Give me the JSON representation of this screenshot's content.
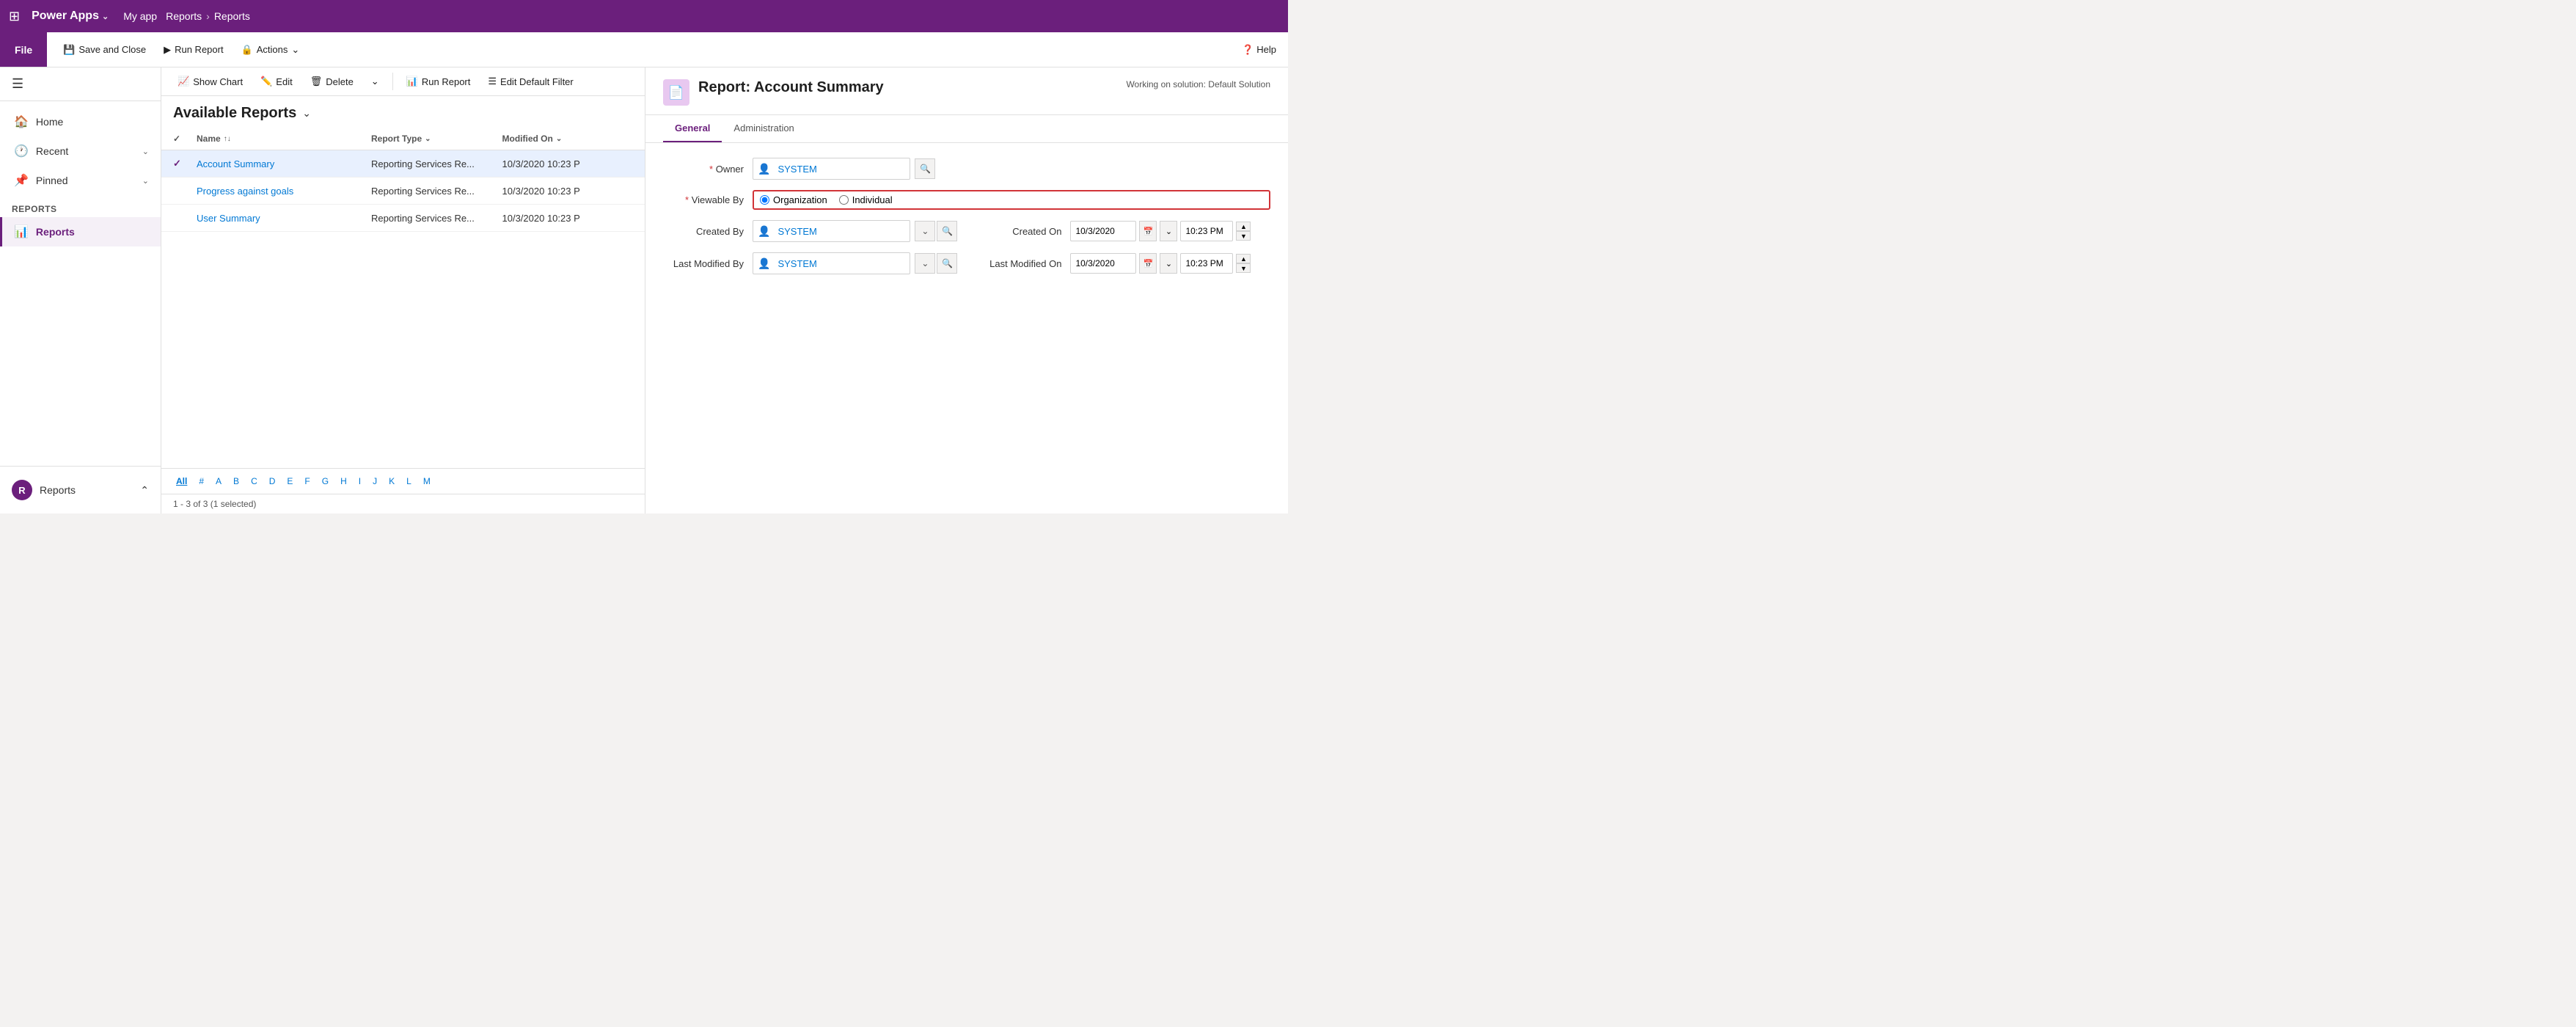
{
  "topnav": {
    "waffle": "⊞",
    "app_name": "Power Apps",
    "chevron": "⌄",
    "my_app": "My app",
    "breadcrumb": [
      "Reports",
      "Reports"
    ]
  },
  "ribbon": {
    "file_label": "File",
    "save_close_label": "Save and Close",
    "run_report_label": "Run Report",
    "actions_label": "Actions",
    "help_label": "Help",
    "save_icon": "💾",
    "run_icon": "▶",
    "actions_icon": "🔒"
  },
  "toolbar": {
    "show_chart": "Show Chart",
    "edit": "Edit",
    "delete": "Delete",
    "run_report": "Run Report",
    "edit_default_filter": "Edit Default Filter"
  },
  "content": {
    "header": "Available Reports",
    "table_headers": {
      "name": "Name",
      "report_type": "Report Type",
      "modified_on": "Modified On"
    },
    "rows": [
      {
        "name": "Account Summary",
        "type": "Reporting Services Re...",
        "modified": "10/3/2020 10:23 P",
        "selected": true
      },
      {
        "name": "Progress against goals",
        "type": "Reporting Services Re...",
        "modified": "10/3/2020 10:23 P",
        "selected": false
      },
      {
        "name": "User Summary",
        "type": "Reporting Services Re...",
        "modified": "10/3/2020 10:23 P",
        "selected": false
      }
    ],
    "alphabet": [
      "All",
      "#",
      "A",
      "B",
      "C",
      "D",
      "E",
      "F",
      "G",
      "H",
      "I",
      "J",
      "K",
      "L",
      "M"
    ],
    "record_count": "1 - 3 of 3 (1 selected)"
  },
  "form": {
    "title": "Report: Account Summary",
    "working_solution": "Working on solution: Default Solution",
    "tabs": [
      "General",
      "Administration"
    ],
    "active_tab": "General",
    "fields": {
      "owner_label": "Owner",
      "owner_value": "SYSTEM",
      "viewable_by_label": "Viewable By",
      "viewable_by_org": "Organization",
      "viewable_by_ind": "Individual",
      "created_by_label": "Created By",
      "created_by_value": "SYSTEM",
      "last_modified_by_label": "Last Modified By",
      "last_modified_by_value": "SYSTEM",
      "created_on_label": "Created On",
      "created_on_date": "10/3/2020",
      "created_on_time": "10:23 PM",
      "last_modified_on_label": "Last Modified On",
      "last_modified_on_date": "10/3/2020",
      "last_modified_on_time": "10:23 PM"
    }
  },
  "sidebar": {
    "hamburger": "☰",
    "home_label": "Home",
    "recent_label": "Recent",
    "pinned_label": "Pinned",
    "section_label": "Reports",
    "reports_label": "Reports",
    "bottom_section": "Reports",
    "bottom_reports": "Reports",
    "bottom_avatar": "R"
  },
  "icons": {
    "home": "🏠",
    "recent": "🕐",
    "pinned": "📌",
    "reports": "📊",
    "chart": "📈",
    "edit": "✏️",
    "delete": "🗑",
    "run": "▶",
    "filter": "☰",
    "save": "💾",
    "record": "📄",
    "user": "👤",
    "calendar": "📅",
    "chevron_down": "⌄",
    "chevron_up": "⌃"
  }
}
